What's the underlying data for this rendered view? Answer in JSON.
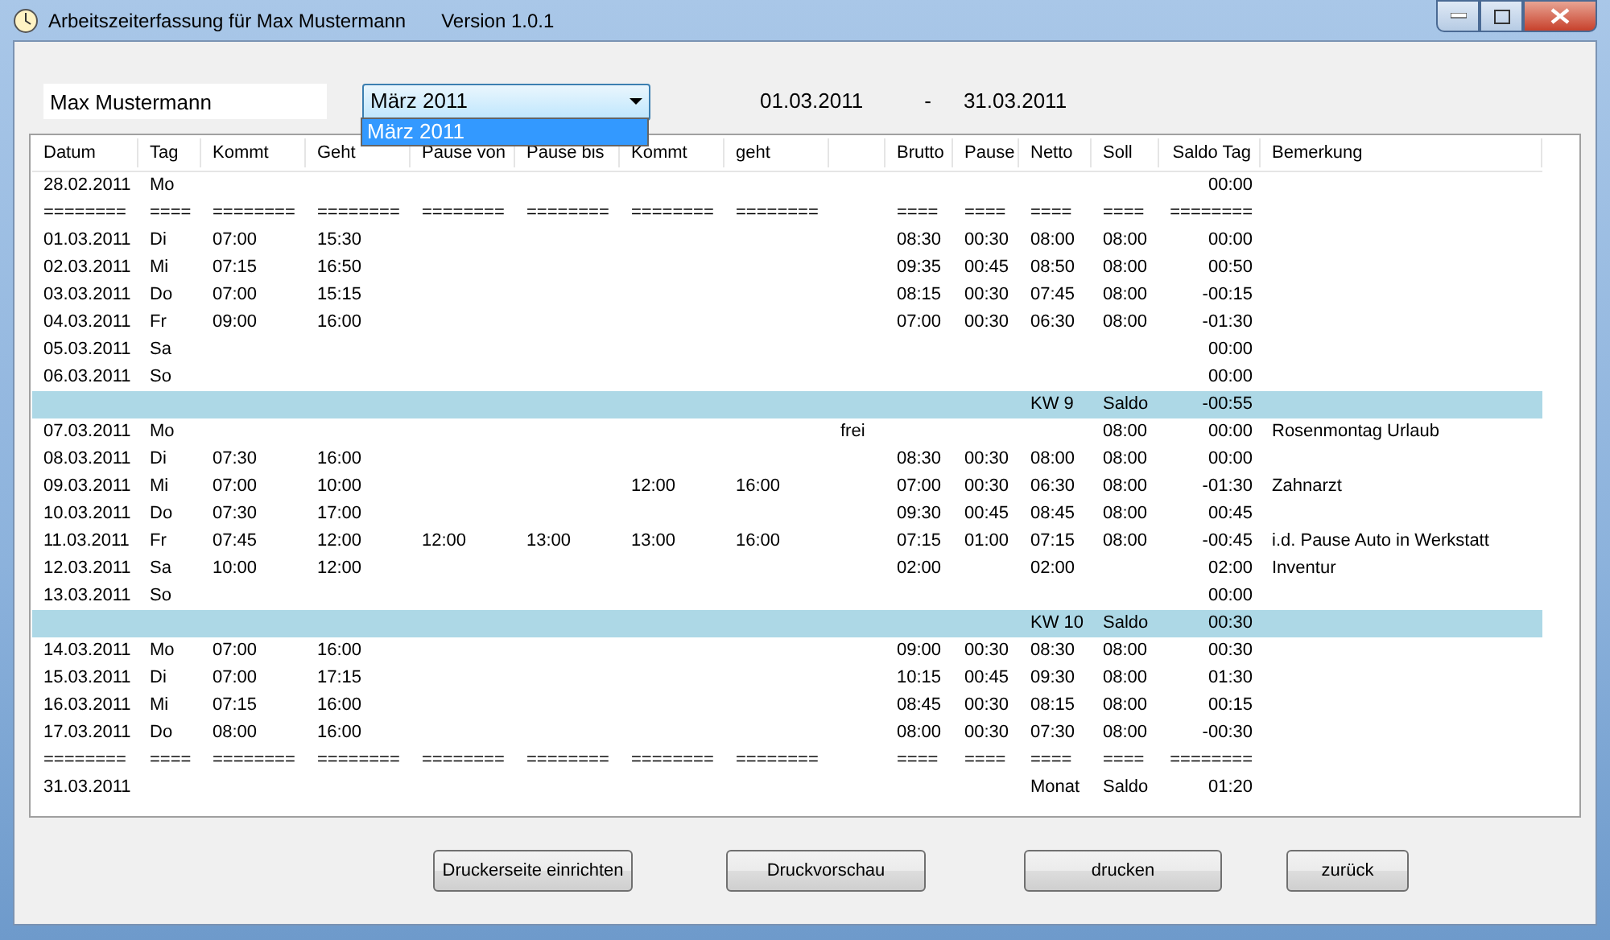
{
  "window": {
    "title": "Arbeitszeiterfassung für Max Mustermann",
    "version": "Version 1.0.1"
  },
  "employee_field": {
    "value": "Max Mustermann"
  },
  "month_select": {
    "value": "März 2011",
    "expanded": true,
    "options": [
      {
        "label": "März 2011",
        "selected": true
      }
    ]
  },
  "period": {
    "from": "01.03.2011",
    "separator": "-",
    "to": "31.03.2011"
  },
  "table": {
    "columns": [
      "Datum",
      "Tag",
      "Kommt",
      "Geht",
      "Pause von",
      "Pause bis",
      "Kommt",
      "geht",
      null,
      "Brutto",
      "Pause",
      "Netto",
      "Soll",
      "Saldo Tag",
      "Bemerkung"
    ],
    "rows": [
      {
        "kind": "data",
        "cells": [
          "28.02.2011",
          "Mo",
          null,
          null,
          null,
          null,
          null,
          null,
          null,
          null,
          null,
          null,
          null,
          "00:00",
          null
        ]
      },
      {
        "kind": "data",
        "cells": [
          "========",
          "====",
          "========",
          "========",
          "========",
          "========",
          "========",
          "========",
          null,
          "====",
          "====",
          "====",
          "====",
          "========",
          null
        ]
      },
      {
        "kind": "data",
        "cells": [
          "01.03.2011",
          "Di",
          "07:00",
          "15:30",
          null,
          null,
          null,
          null,
          null,
          "08:30",
          "00:30",
          "08:00",
          "08:00",
          "00:00",
          null
        ]
      },
      {
        "kind": "data",
        "cells": [
          "02.03.2011",
          "Mi",
          "07:15",
          "16:50",
          null,
          null,
          null,
          null,
          null,
          "09:35",
          "00:45",
          "08:50",
          "08:00",
          "00:50",
          null
        ]
      },
      {
        "kind": "data",
        "cells": [
          "03.03.2011",
          "Do",
          "07:00",
          "15:15",
          null,
          null,
          null,
          null,
          null,
          "08:15",
          "00:30",
          "07:45",
          "08:00",
          "-00:15",
          null
        ]
      },
      {
        "kind": "data",
        "cells": [
          "04.03.2011",
          "Fr",
          "09:00",
          "16:00",
          null,
          null,
          null,
          null,
          null,
          "07:00",
          "00:30",
          "06:30",
          "08:00",
          "-01:30",
          null
        ]
      },
      {
        "kind": "data",
        "cells": [
          "05.03.2011",
          "Sa",
          null,
          null,
          null,
          null,
          null,
          null,
          null,
          null,
          null,
          null,
          null,
          "00:00",
          null
        ]
      },
      {
        "kind": "data",
        "cells": [
          "06.03.2011",
          "So",
          null,
          null,
          null,
          null,
          null,
          null,
          null,
          null,
          null,
          null,
          null,
          "00:00",
          null
        ]
      },
      {
        "kind": "week",
        "cells": [
          null,
          null,
          null,
          null,
          null,
          null,
          null,
          null,
          null,
          null,
          null,
          "KW 9",
          "Saldo",
          "-00:55",
          null
        ]
      },
      {
        "kind": "data",
        "cells": [
          "07.03.2011",
          "Mo",
          null,
          null,
          null,
          null,
          null,
          null,
          "frei",
          null,
          null,
          null,
          "08:00",
          "00:00",
          "Rosenmontag Urlaub"
        ]
      },
      {
        "kind": "data",
        "cells": [
          "08.03.2011",
          "Di",
          "07:30",
          "16:00",
          null,
          null,
          null,
          null,
          null,
          "08:30",
          "00:30",
          "08:00",
          "08:00",
          "00:00",
          null
        ]
      },
      {
        "kind": "data",
        "cells": [
          "09.03.2011",
          "Mi",
          "07:00",
          "10:00",
          null,
          null,
          "12:00",
          "16:00",
          null,
          "07:00",
          "00:30",
          "06:30",
          "08:00",
          "-01:30",
          "Zahnarzt"
        ]
      },
      {
        "kind": "data",
        "cells": [
          "10.03.2011",
          "Do",
          "07:30",
          "17:00",
          null,
          null,
          null,
          null,
          null,
          "09:30",
          "00:45",
          "08:45",
          "08:00",
          "00:45",
          null
        ]
      },
      {
        "kind": "data",
        "cells": [
          "11.03.2011",
          "Fr",
          "07:45",
          "12:00",
          "12:00",
          "13:00",
          "13:00",
          "16:00",
          null,
          "07:15",
          "01:00",
          "07:15",
          "08:00",
          "-00:45",
          "i.d. Pause Auto in Werkstatt"
        ]
      },
      {
        "kind": "data",
        "cells": [
          "12.03.2011",
          "Sa",
          "10:00",
          "12:00",
          null,
          null,
          null,
          null,
          null,
          "02:00",
          null,
          "02:00",
          null,
          "02:00",
          "Inventur"
        ]
      },
      {
        "kind": "data",
        "cells": [
          "13.03.2011",
          "So",
          null,
          null,
          null,
          null,
          null,
          null,
          null,
          null,
          null,
          null,
          null,
          "00:00",
          null
        ]
      },
      {
        "kind": "week",
        "cells": [
          null,
          null,
          null,
          null,
          null,
          null,
          null,
          null,
          null,
          null,
          null,
          "KW 10",
          "Saldo",
          "00:30",
          null
        ]
      },
      {
        "kind": "data",
        "cells": [
          "14.03.2011",
          "Mo",
          "07:00",
          "16:00",
          null,
          null,
          null,
          null,
          null,
          "09:00",
          "00:30",
          "08:30",
          "08:00",
          "00:30",
          null
        ]
      },
      {
        "kind": "data",
        "cells": [
          "15.03.2011",
          "Di",
          "07:00",
          "17:15",
          null,
          null,
          null,
          null,
          null,
          "10:15",
          "00:45",
          "09:30",
          "08:00",
          "01:30",
          null
        ]
      },
      {
        "kind": "data",
        "cells": [
          "16.03.2011",
          "Mi",
          "07:15",
          "16:00",
          null,
          null,
          null,
          null,
          null,
          "08:45",
          "00:30",
          "08:15",
          "08:00",
          "00:15",
          null
        ]
      },
      {
        "kind": "data",
        "cells": [
          "17.03.2011",
          "Do",
          "08:00",
          "16:00",
          null,
          null,
          null,
          null,
          null,
          "08:00",
          "00:30",
          "07:30",
          "08:00",
          "-00:30",
          null
        ]
      },
      {
        "kind": "data",
        "cells": [
          "========",
          "====",
          "========",
          "========",
          "========",
          "========",
          "========",
          "========",
          null,
          "====",
          "====",
          "====",
          "====",
          "========",
          null
        ]
      },
      {
        "kind": "data",
        "cells": [
          "31.03.2011",
          null,
          null,
          null,
          null,
          null,
          null,
          null,
          null,
          null,
          null,
          "Monat",
          "Saldo",
          "01:20",
          null
        ]
      }
    ]
  },
  "buttons": [
    {
      "label": "Druckerseite einrichten"
    },
    {
      "label": "Druckvorschau"
    },
    {
      "label": "drucken"
    },
    {
      "label": "zurück"
    }
  ]
}
